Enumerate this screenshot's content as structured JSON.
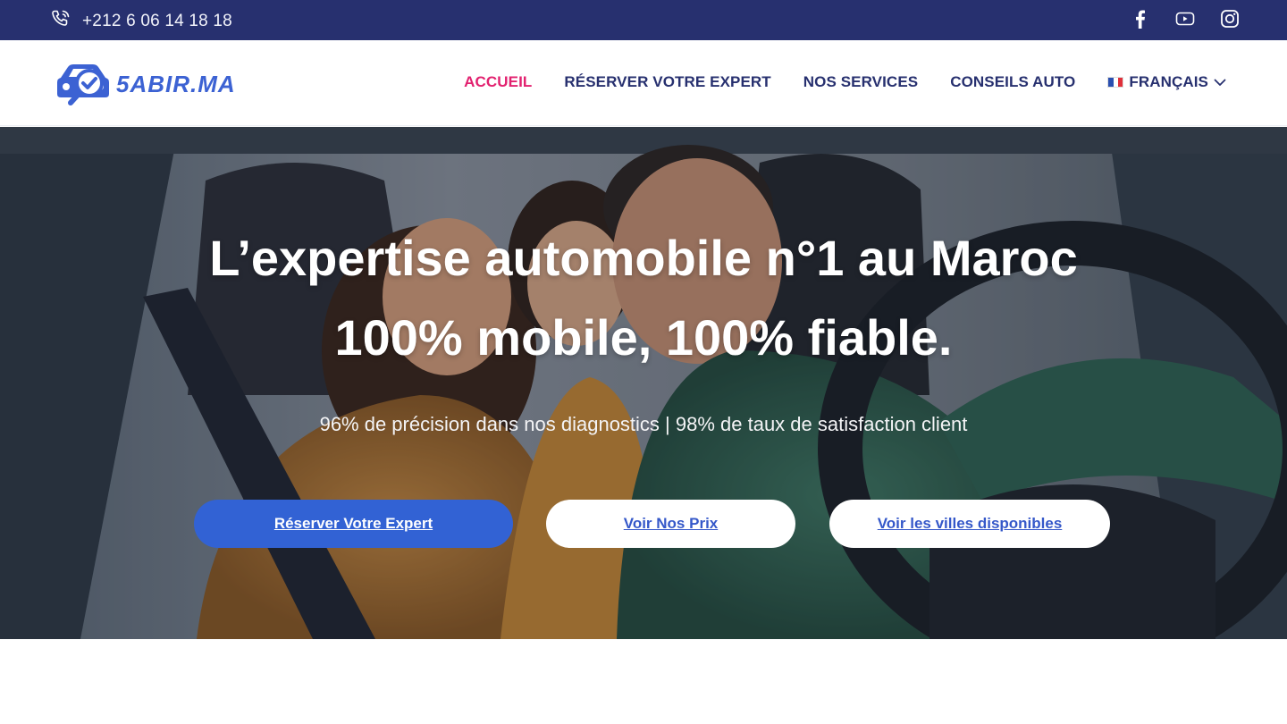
{
  "topbar": {
    "phone": "+212 6 06 14 18 18",
    "phone_icon": "phone-icon",
    "socials": [
      "facebook-icon",
      "youtube-icon",
      "instagram-icon"
    ]
  },
  "header": {
    "logo_text": "5ABIR.MA",
    "nav": [
      {
        "label": "ACCUEIL",
        "active": true
      },
      {
        "label": "RÉSERVER VOTRE EXPERT"
      },
      {
        "label": "NOS SERVICES"
      },
      {
        "label": "CONSEILS AUTO"
      }
    ],
    "language": "FRANÇAIS"
  },
  "hero": {
    "title_line1": "L’expertise automobile n°1 au Maroc",
    "title_line2": "100% mobile, 100% fiable.",
    "subtitle": "96% de précision dans nos diagnostics | 98% de taux de satisfaction client",
    "buttons": {
      "primary": "Réserver Votre Expert",
      "prices": "Voir Nos Prix",
      "cities": "Voir les villes disponibles"
    }
  },
  "colors": {
    "topbar": "#27306f",
    "nav_text": "#27306f",
    "nav_active": "#e2216f",
    "brand_blue": "#3262d4"
  }
}
